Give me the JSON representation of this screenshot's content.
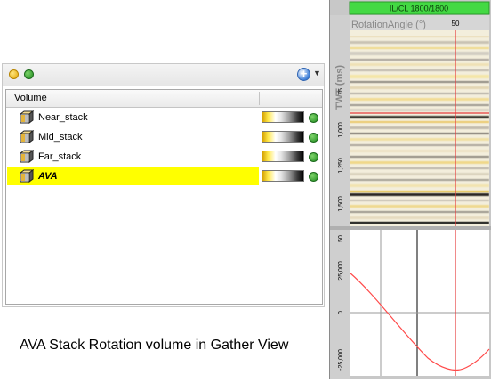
{
  "panel": {
    "column_header": "Volume",
    "rows": [
      {
        "label": "Near_stack",
        "selected": false
      },
      {
        "label": "Mid_stack",
        "selected": false
      },
      {
        "label": "Far_stack",
        "selected": false
      },
      {
        "label": "AVA",
        "selected": true
      }
    ]
  },
  "caption": "AVA Stack Rotation volume in Gather View",
  "gather": {
    "banner": "IL/CL 1800/1800",
    "x_label": "RotationAngle (°)",
    "x_tick": "50",
    "y_label": "TWT (ms)",
    "y_ticks": [
      "75",
      "1,000",
      "1,250",
      "1,500"
    ],
    "curve_ticks": [
      "50",
      "25,000",
      "0",
      "-25,000"
    ]
  },
  "colors": {
    "selection": "#ffff00",
    "banner": "#43d943",
    "status": "#1f8a1f",
    "curve": "#ff3c3c"
  }
}
